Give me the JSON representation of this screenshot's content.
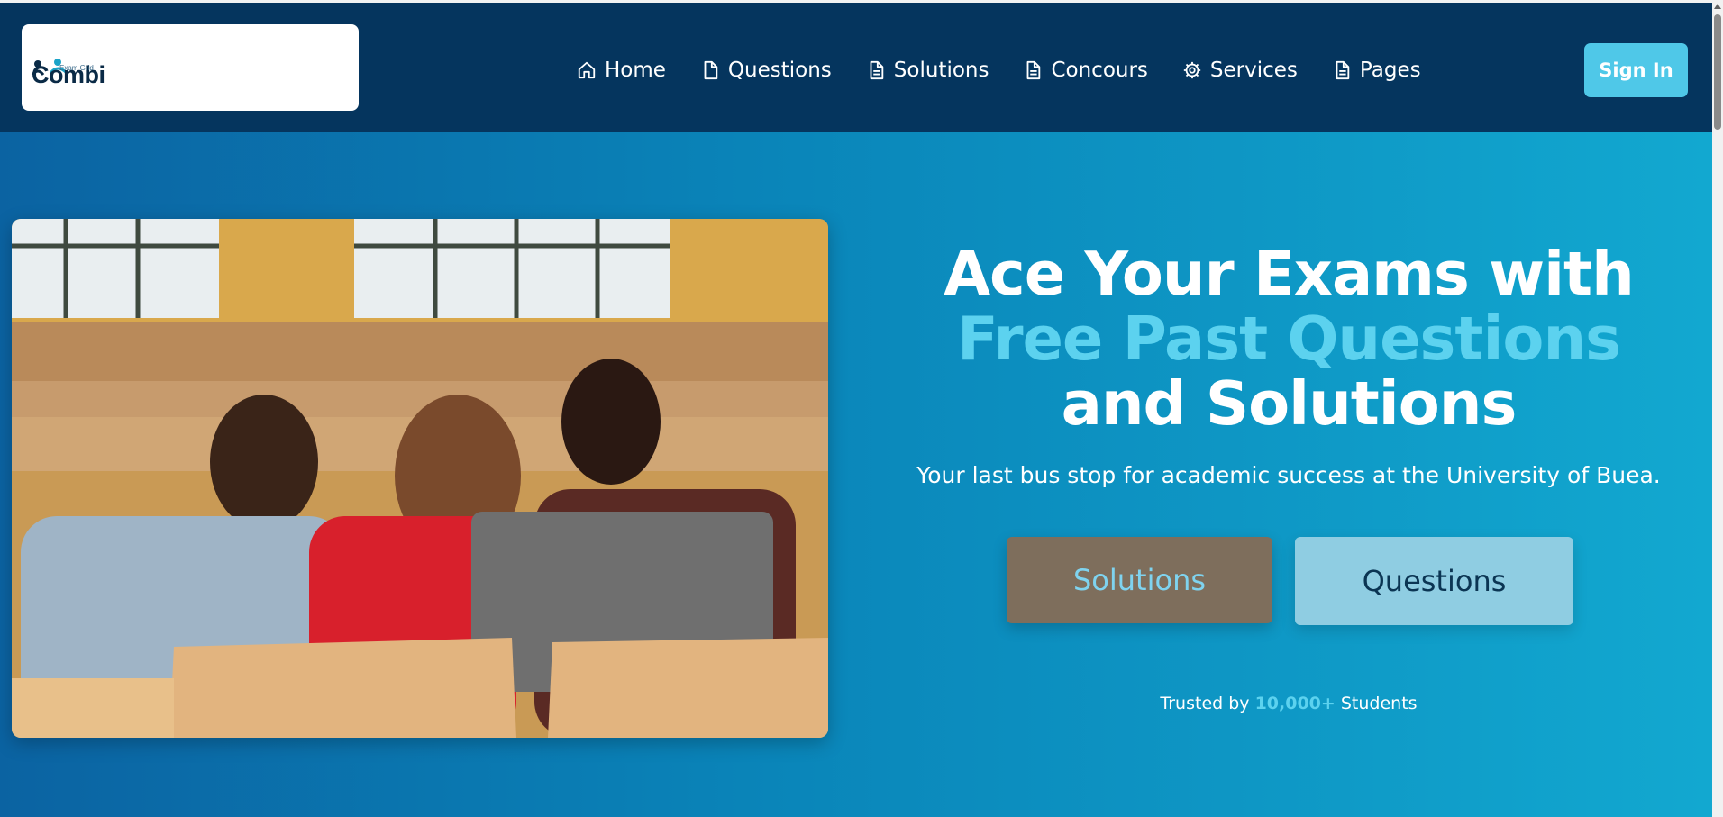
{
  "header": {
    "logo_text": "Combi",
    "logo_tagline": "Exam Grid",
    "nav": [
      {
        "label": "Home",
        "icon": "home-icon"
      },
      {
        "label": "Questions",
        "icon": "document-icon"
      },
      {
        "label": "Solutions",
        "icon": "document-text-icon"
      },
      {
        "label": "Concours",
        "icon": "document-text-icon"
      },
      {
        "label": "Services",
        "icon": "gear-icon"
      },
      {
        "label": "Pages",
        "icon": "document-text-icon"
      }
    ],
    "signin_label": "Sign In"
  },
  "hero": {
    "title_part1": "Ace Your Exams with",
    "title_accent": "Free Past Questions",
    "title_part2": " and Solutions",
    "subtitle": "Your last bus stop for academic success at the University of Buea.",
    "btn_solutions": "Solutions",
    "btn_questions": "Questions",
    "trusted_prefix": "Trusted by ",
    "trusted_count": "10,000+",
    "trusted_suffix": " Students",
    "image_alt": "Three students looking at a laptop in a lecture hall"
  },
  "colors": {
    "header_bg": "#05355e",
    "accent": "#5cd2ef",
    "signin_bg": "#4fc8e8",
    "solutions_btn_bg": "#7e6e5c",
    "questions_btn_bg": "#8fcde2"
  }
}
